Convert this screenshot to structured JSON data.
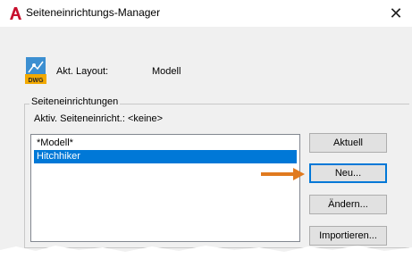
{
  "window": {
    "title": "Seiteneinrichtungs-Manager",
    "close_glyph": "✕"
  },
  "layout": {
    "label": "Akt. Layout:",
    "value": "Modell",
    "icon": "dwg-file-icon",
    "icon_text": "DWG"
  },
  "page_setups": {
    "group_title": "Seiteneinrichtungen",
    "current_label": "Aktiv. Seiteneinricht.: <keine>",
    "items": [
      {
        "label": "*Modell*",
        "selected": false
      },
      {
        "label": "Hitchhiker",
        "selected": true
      }
    ]
  },
  "buttons": {
    "current": "Aktuell",
    "new": "Neu...",
    "modify": "Ändern...",
    "import": "Importieren..."
  },
  "colors": {
    "selection": "#0078d7",
    "callout_arrow": "#e07a1f",
    "app_red": "#c8102e"
  }
}
